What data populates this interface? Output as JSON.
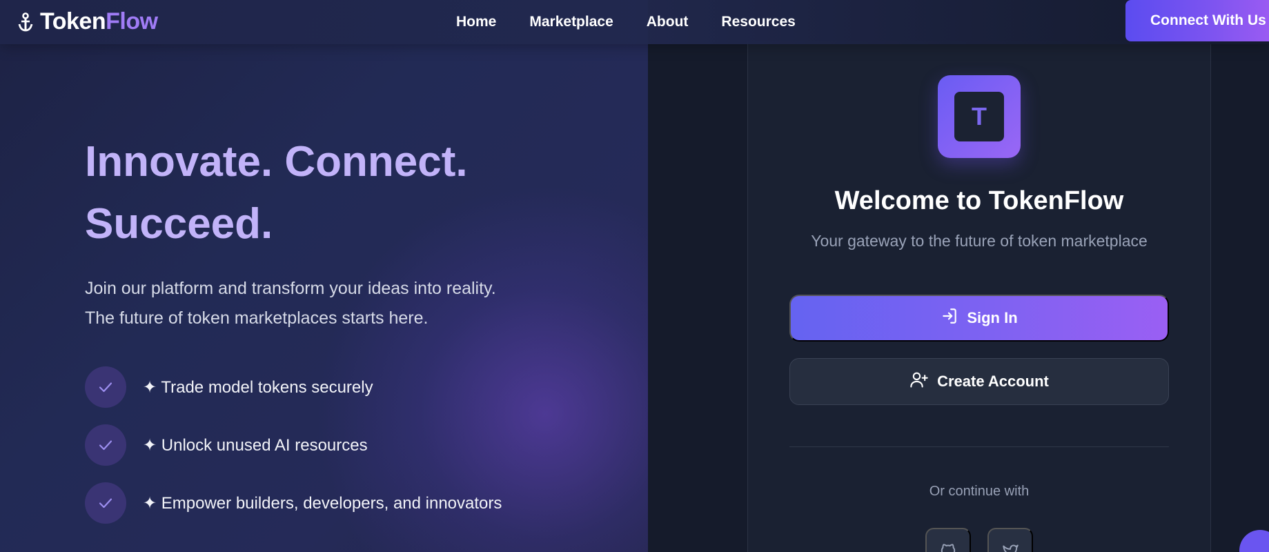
{
  "nav": {
    "logo_part1": "Token",
    "logo_part2": "Flow",
    "links": [
      "Home",
      "Marketplace",
      "About",
      "Resources"
    ],
    "cta": "Connect With Us"
  },
  "hero": {
    "headline_line1": "Innovate. Connect.",
    "headline_line2": "Succeed.",
    "subtext_line1": "Join our platform and transform your ideas into reality.",
    "subtext_line2": "The future of token marketplaces starts here.",
    "features": [
      "✦ Trade model tokens securely",
      "✦ Unlock unused AI resources",
      "✦ Empower builders, developers, and innovators"
    ]
  },
  "card": {
    "avatar_letter": "T",
    "title": "Welcome to TokenFlow",
    "subtitle": "Your gateway to the future of token marketplace",
    "signin_label": "Sign In",
    "create_label": "Create Account",
    "or_text": "Or continue with",
    "social_icons": [
      "github-icon",
      "twitter-icon"
    ]
  },
  "colors": {
    "accent": "#7b5cf0",
    "headline": "#c2b3f9",
    "logo_flow": "#a07cf6"
  }
}
